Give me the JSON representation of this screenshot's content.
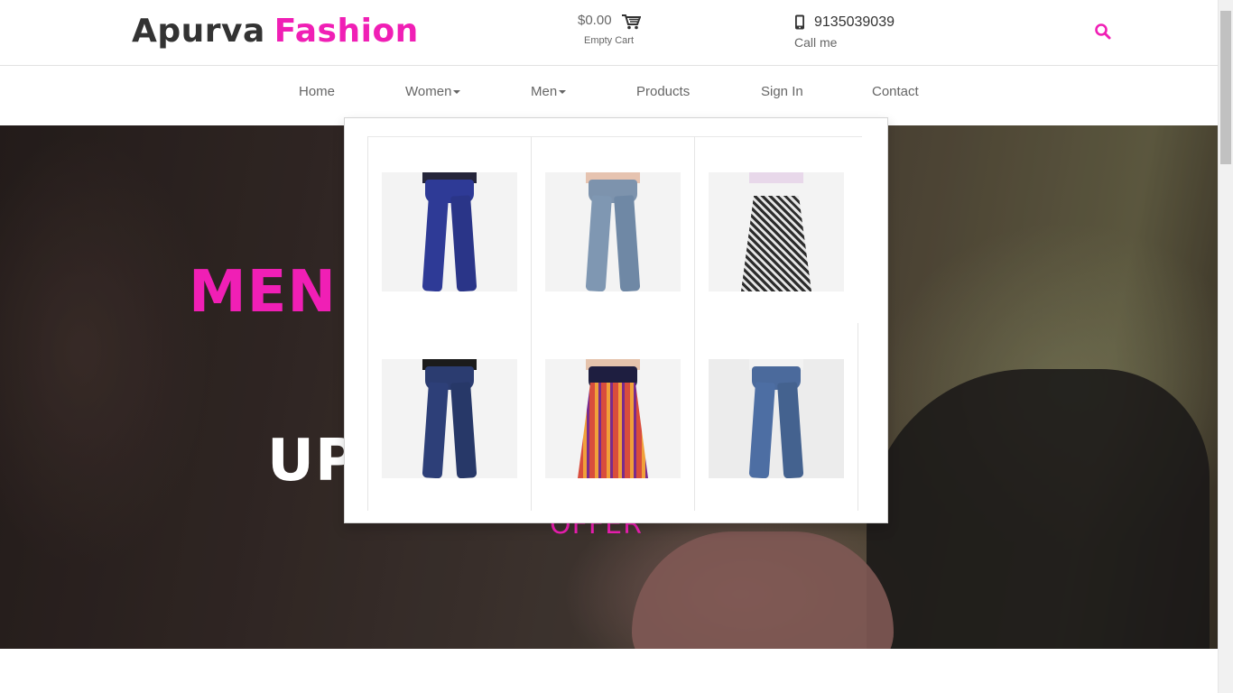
{
  "brand": {
    "part1": "Apurva",
    "part2": "Fashion",
    "accent_color": "#f01fb5",
    "dark_color": "#333333"
  },
  "cart": {
    "price": "$0.00",
    "status": "Empty Cart",
    "icon": "cart-icon"
  },
  "contact": {
    "phone": "9135039039",
    "label": "Call me",
    "icon": "mobile-phone-icon"
  },
  "search": {
    "icon": "search-icon"
  },
  "nav": {
    "home": "Home",
    "women": "Women",
    "men": "Men",
    "products": "Products",
    "signin": "Sign In",
    "contact": "Contact"
  },
  "hero": {
    "title": "MEN",
    "subtitle": "UP",
    "offer": "OFFER"
  },
  "dropdown": {
    "products": [
      {
        "name": "blue-skinny-jeans",
        "color": "#2e3a96"
      },
      {
        "name": "light-wash-jeans",
        "color": "#7d93ad"
      },
      {
        "name": "printed-palazzo",
        "color": "#5a5a5a"
      },
      {
        "name": "high-waist-jeans",
        "color": "#2b3c70"
      },
      {
        "name": "printed-skirt",
        "color": "#d94d3c"
      },
      {
        "name": "mid-wash-jeans",
        "color": "#4b6a9c"
      }
    ]
  }
}
